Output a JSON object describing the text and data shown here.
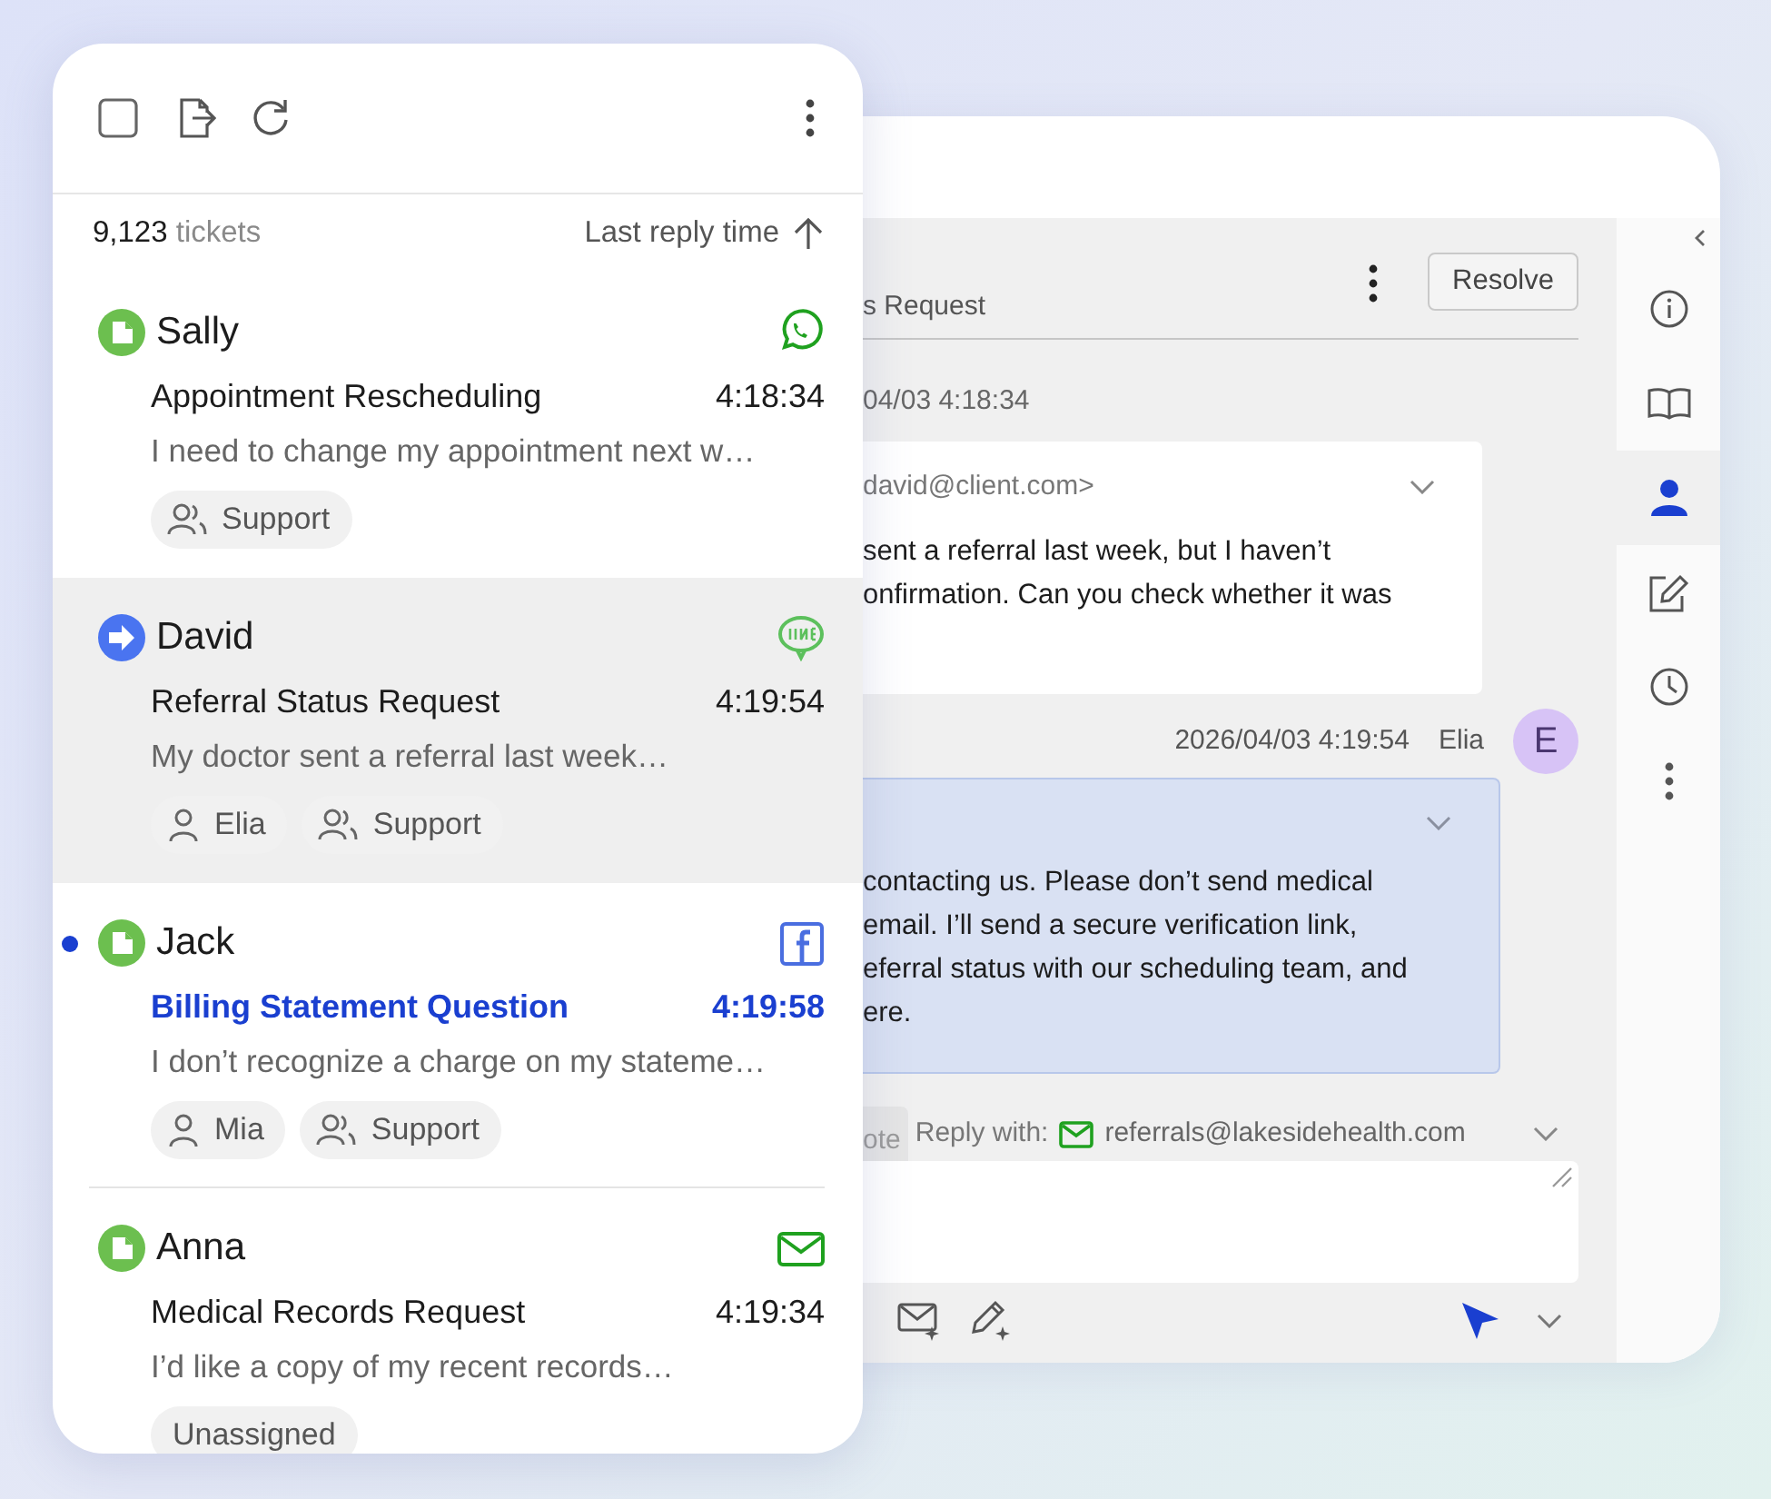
{
  "toolbar": {
    "select_all": {
      "checked": false
    }
  },
  "list_header": {
    "count": "9,123",
    "count_unit": "tickets",
    "sort_label": "Last reply time"
  },
  "tickets": [
    {
      "name": "Sally",
      "status": {
        "kind": "draft"
      },
      "channel": {
        "kind": "whatsapp"
      },
      "subject": "Appointment Rescheduling",
      "time": "4:18:34",
      "preview": "I need to change my appointment next w…",
      "tags": [
        {
          "kind": "team",
          "label": "Support"
        }
      ],
      "selected": false,
      "unread": false
    },
    {
      "name": "David",
      "status": {
        "kind": "forwarded"
      },
      "channel": {
        "kind": "line"
      },
      "subject": "Referral Status Request",
      "time": "4:19:54",
      "preview": "My doctor sent a referral last week…",
      "tags": [
        {
          "kind": "agent",
          "label": "Elia"
        },
        {
          "kind": "team",
          "label": "Support"
        }
      ],
      "selected": true,
      "unread": false
    },
    {
      "name": "Jack",
      "status": {
        "kind": "draft"
      },
      "channel": {
        "kind": "facebook"
      },
      "subject": "Billing Statement Question",
      "time": "4:19:58",
      "preview": "I don’t recognize a charge on my stateme…",
      "tags": [
        {
          "kind": "agent",
          "label": "Mia"
        },
        {
          "kind": "team",
          "label": "Support"
        }
      ],
      "selected": false,
      "unread": true
    },
    {
      "name": "Anna",
      "status": {
        "kind": "draft"
      },
      "channel": {
        "kind": "email"
      },
      "subject": "Medical Records Request",
      "time": "4:19:34",
      "preview": "I’d like a copy of my recent records…",
      "tags": [
        {
          "kind": "plain",
          "label": "Unassigned"
        }
      ],
      "selected": false,
      "unread": false
    }
  ],
  "conversation": {
    "subject": "s Request",
    "resolve_button": "Resolve",
    "messages": [
      {
        "kind": "incoming",
        "timestamp": "04/03 4:18:34",
        "sender": "david@client.com>",
        "lines": [
          "sent a referral last week, but I haven’t",
          "onfirmation. Can you check whether it was"
        ]
      },
      {
        "kind": "outgoing",
        "timestamp": "2026/04/03 4:19:54",
        "agent": "Elia",
        "avatar_initial": "E",
        "lines": [
          "contacting us. Please don’t send medical",
          "email. I’ll send a secure verification link,",
          "eferral status with our scheduling team, and",
          "ere."
        ]
      }
    ],
    "composer": {
      "tab": "ote",
      "reply_label": "Reply with:",
      "reply_address": "referrals@lakesidehealth.com"
    }
  },
  "sidebar": {
    "items": [
      {
        "kind": "info",
        "selected": false
      },
      {
        "kind": "book",
        "selected": false
      },
      {
        "kind": "person",
        "selected": true
      },
      {
        "kind": "edit",
        "selected": false
      },
      {
        "kind": "clock",
        "selected": false
      },
      {
        "kind": "more",
        "selected": false
      }
    ]
  }
}
